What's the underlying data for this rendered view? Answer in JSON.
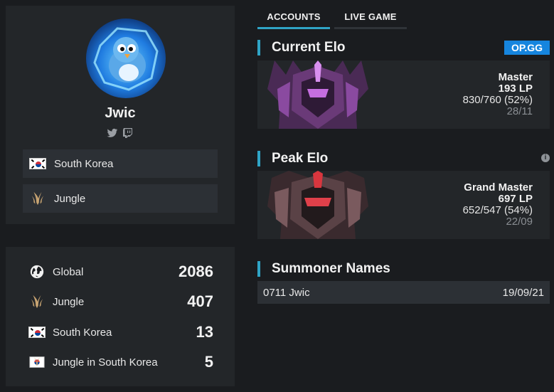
{
  "profile": {
    "name": "Jwic",
    "region": "South Korea",
    "role": "Jungle"
  },
  "rankings": [
    {
      "label": "Global",
      "value": "2086",
      "icon": "globe-icon"
    },
    {
      "label": "Jungle",
      "value": "407",
      "icon": "jungle-icon"
    },
    {
      "label": "South Korea",
      "value": "13",
      "icon": "korea-flag-icon"
    },
    {
      "label": "Jungle in South Korea",
      "value": "5",
      "icon": "jungle-korea-icon"
    }
  ],
  "tabs": {
    "accounts": "ACCOUNTS",
    "live_game": "LIVE GAME"
  },
  "current_elo": {
    "title": "Current Elo",
    "badge": "OP.GG",
    "tier": "Master",
    "lp": "193 LP",
    "winloss": "830/760 (52%)",
    "date": "28/11"
  },
  "peak_elo": {
    "title": "Peak Elo",
    "info": "i",
    "tier": "Grand Master",
    "lp": "697 LP",
    "winloss": "652/547 (54%)",
    "date": "22/09"
  },
  "summoner_names": {
    "title": "Summoner Names",
    "entries": [
      {
        "name": "0711 Jwic",
        "date": "19/09/21"
      }
    ]
  },
  "colors": {
    "accent": "#2fa4c6",
    "opgg": "#1685de",
    "panel": "#232629",
    "row": "#2c3035"
  }
}
